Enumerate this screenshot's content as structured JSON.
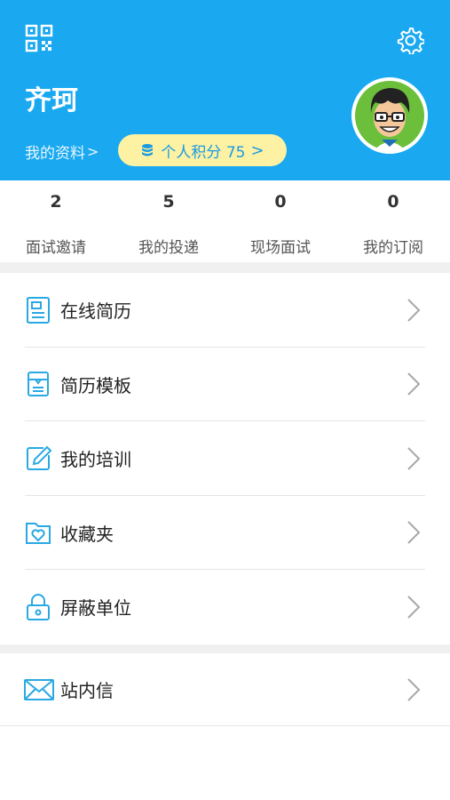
{
  "header": {
    "user_name": "齐珂",
    "profile_link": "我的资料",
    "points_label": "个人积分 75",
    "icons": {
      "qr": "qr-code-icon",
      "settings": "gear-icon",
      "coins": "coins-icon"
    },
    "colors": {
      "bg": "#1aa9f0",
      "points_bg": "#fdf1a4"
    }
  },
  "stats": [
    {
      "value": "2",
      "label": "面试邀请"
    },
    {
      "value": "5",
      "label": "我的投递"
    },
    {
      "value": "0",
      "label": "现场面试"
    },
    {
      "value": "0",
      "label": "我的订阅"
    }
  ],
  "menu": [
    {
      "label": "在线简历",
      "icon": "resume-icon"
    },
    {
      "label": "简历模板",
      "icon": "template-icon"
    },
    {
      "label": "我的培训",
      "icon": "edit-icon"
    },
    {
      "label": "收藏夹",
      "icon": "favorite-folder-icon"
    },
    {
      "label": "屏蔽单位",
      "icon": "lock-icon"
    }
  ],
  "messages": {
    "label": "站内信",
    "icon": "mail-icon"
  },
  "chevron": ">"
}
